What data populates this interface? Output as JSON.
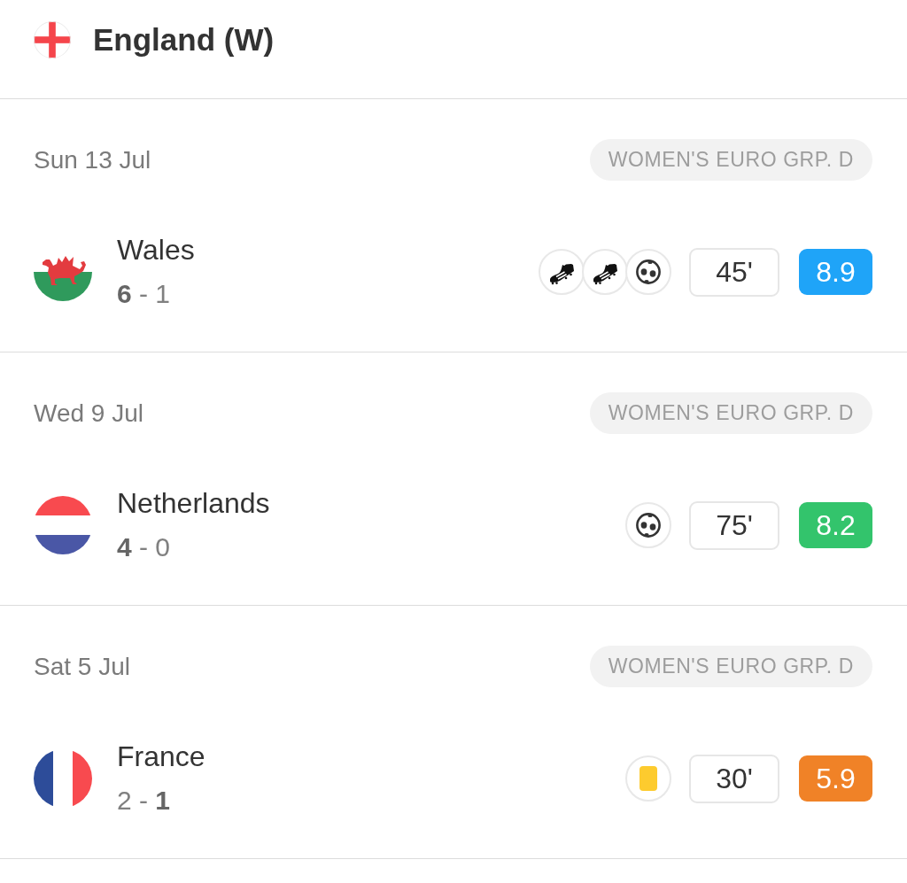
{
  "team": {
    "name": "England (W)",
    "kind": "england"
  },
  "matches": [
    {
      "date": "Sun 13 Jul",
      "competition": "WOMEN'S EURO GRP. D",
      "opponent": {
        "name": "Wales",
        "kind": "wales"
      },
      "score": "**6** - 1",
      "events": [
        {
          "kind": "boot"
        },
        {
          "kind": "boot"
        },
        {
          "kind": "ball"
        }
      ],
      "minutes": "45'",
      "rating": {
        "value": "8.9",
        "color": "#1fa4f8"
      }
    },
    {
      "date": "Wed 9 Jul",
      "competition": "WOMEN'S EURO GRP. D",
      "opponent": {
        "name": "Netherlands",
        "kind": "netherlands"
      },
      "score": "**4** - 0",
      "events": [
        {
          "kind": "ball"
        }
      ],
      "minutes": "75'",
      "rating": {
        "value": "8.2",
        "color": "#33c46c"
      }
    },
    {
      "date": "Sat 5 Jul",
      "competition": "WOMEN'S EURO GRP. D",
      "opponent": {
        "name": "France",
        "kind": "france"
      },
      "score": "2 - **1**",
      "events": [
        {
          "kind": "card"
        }
      ],
      "minutes": "30'",
      "rating": {
        "value": "5.9",
        "color": "#f08227"
      }
    }
  ]
}
